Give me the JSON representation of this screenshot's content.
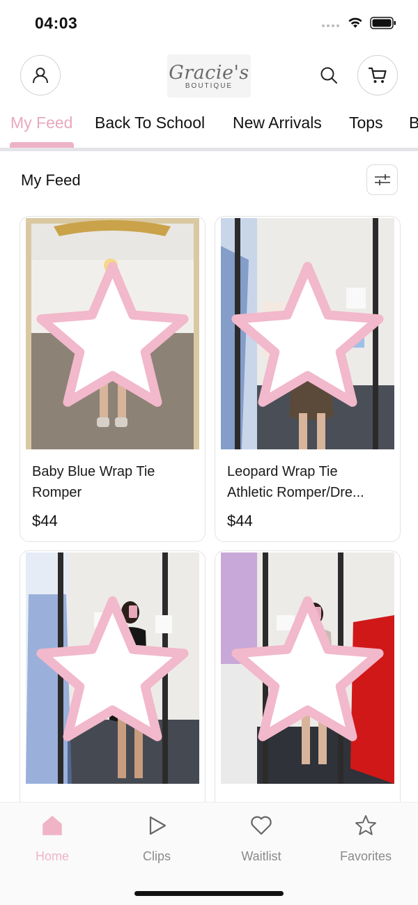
{
  "status_bar": {
    "time": "04:03",
    "icons": [
      "signal-dots",
      "wifi-icon",
      "battery-icon"
    ]
  },
  "header": {
    "logo_script": "Gracie's",
    "logo_sub": "BOUTIQUE",
    "icons": [
      "account-icon",
      "search-icon",
      "cart-icon"
    ]
  },
  "tabs": [
    {
      "label": "My Feed",
      "active": true
    },
    {
      "label": "Back To School",
      "active": false
    },
    {
      "label": "New Arrivals",
      "active": false
    },
    {
      "label": "Tops",
      "active": false
    },
    {
      "label": "B",
      "active": false
    }
  ],
  "feed": {
    "title": "My Feed",
    "filter_icon": "sliders-icon"
  },
  "products": [
    {
      "name_line1": "Baby Blue Wrap Tie",
      "name_line2": "Romper",
      "price": "$44",
      "outfit_color": "#a9d3ea"
    },
    {
      "name_line1": "Leopard Wrap Tie",
      "name_line2": "Athletic Romper/Dre...",
      "price": "$44",
      "outfit_color": "#5b4a3a"
    },
    {
      "name_line1": "",
      "name_line2": "",
      "price": "",
      "outfit_color": "#151515"
    },
    {
      "name_line1": "",
      "name_line2": "",
      "price": "",
      "outfit_color": "#c9bbb0"
    }
  ],
  "bottom_nav": [
    {
      "label": "Home",
      "icon": "home-icon",
      "active": true
    },
    {
      "label": "Clips",
      "icon": "play-icon",
      "active": false
    },
    {
      "label": "Waitlist",
      "icon": "heart-icon",
      "active": false
    },
    {
      "label": "Favorites",
      "icon": "star-icon",
      "active": false
    }
  ],
  "colors": {
    "accent_pink": "#eeb2c6",
    "text_dark": "#111111",
    "muted_gray": "#8a8a8a",
    "divider": "#e4e4e8"
  }
}
